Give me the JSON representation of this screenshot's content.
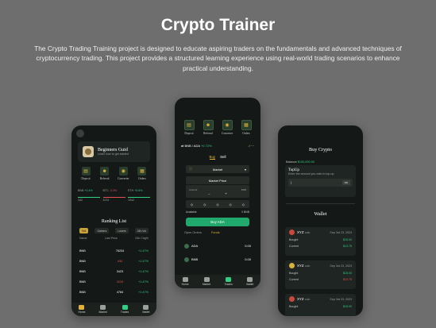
{
  "header": {
    "title": "Crypto Trainer",
    "description": "The Crypto Trading Training project is designed to educate aspiring traders on the fundamentals and advanced techniques of cryptocurrency trading. This project provides a structured learning experience using real-world trading scenarios to enhance practical understanding."
  },
  "phone1": {
    "guide_title": "Beginners Guid",
    "guide_sub": "Learn how to get started",
    "actions": [
      "Deposit",
      "Referral",
      "Converter",
      "Orders"
    ],
    "tickers": [
      {
        "pair": "BNB",
        "price": "342",
        "change": "+0.4%"
      },
      {
        "pair": "BTC",
        "price": "4231",
        "change": "-0.3%"
      },
      {
        "pair": "ETH",
        "price": "1942",
        "change": "+0.6%"
      }
    ],
    "ranking_title": "Ranking List",
    "filters": [
      "Hot",
      "Gainers",
      "Losers",
      "24h Vol"
    ],
    "columns": [
      "Name",
      "Last Price",
      "24h Chg%"
    ],
    "rows": [
      {
        "name": "BNB",
        "price": "76234",
        "change": "+1.47%"
      },
      {
        "name": "BNB",
        "price": "434",
        "change": "+1.47%"
      },
      {
        "name": "BNB",
        "price": "3423",
        "change": "+1.47%"
      },
      {
        "name": "BNB",
        "price": "4234",
        "change": "+1.47%"
      },
      {
        "name": "BNB",
        "price": "4784",
        "change": "+1.47%"
      }
    ]
  },
  "phone2": {
    "actions": [
      "Deposit",
      "Referral",
      "Converter",
      "Orders"
    ],
    "pair": "BNB / ADA",
    "pair_change": "+0.72%",
    "buy_tab": "Buy",
    "sell_tab": "Sell",
    "order_type": "Market",
    "market_price": "Market Price",
    "amount_label": "Amount",
    "amount_unit": "BNB",
    "available_label": "Available",
    "available_value": "0 BNB",
    "buy_button": "Buy ADA",
    "tab_orders": "Open Orders",
    "tab_funds": "Funds",
    "funds": [
      {
        "coin": "ADA",
        "value": "0.00"
      },
      {
        "coin": "BNB",
        "value": "0.00"
      }
    ]
  },
  "phone3": {
    "title": "Buy Crypto",
    "balance_label": "Balance",
    "balance_value": "$100,000.00",
    "topup_title": "TopUp",
    "topup_hint": "Enter the amount you wish to top up",
    "topup_ok": "OK",
    "wallet_title": "Wallet",
    "cards": [
      {
        "coin": "XYZ",
        "tag": "coin",
        "date": "Sep 3rd 23, 2023",
        "bought": "$15.00",
        "current": "$13.75"
      },
      {
        "coin": "XYZ",
        "tag": "coin",
        "date": "Sep 3rd 23, 2023",
        "bought": "$15.00",
        "current": "$13.75"
      },
      {
        "coin": "XYZ",
        "tag": "coin",
        "date": "Sep 3rd 23, 2023",
        "bought": "$15.00",
        "current": "$13.75"
      }
    ],
    "bought_label": "Bought",
    "current_label": "Current"
  },
  "nav": [
    "Home",
    "Market",
    "Trades",
    "Wallet"
  ],
  "colors": {
    "accent_green": "#21a86d",
    "gold": "#e0b23a",
    "background": "#6e6e6e",
    "phone_bg": "#141816"
  }
}
